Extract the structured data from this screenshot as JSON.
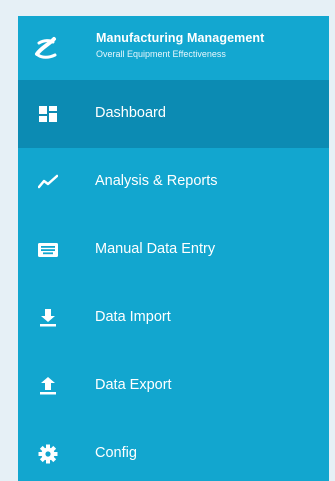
{
  "app": {
    "title": "Manufacturing Management",
    "subtitle": "Overall Equipment Effectiveness"
  },
  "menu": {
    "items": [
      {
        "label": "Dashboard",
        "icon": "dashboard-icon",
        "active": true
      },
      {
        "label": "Analysis & Reports",
        "icon": "line-chart-icon",
        "active": false
      },
      {
        "label": "Manual Data Entry",
        "icon": "keyboard-icon",
        "active": false
      },
      {
        "label": "Data Import",
        "icon": "download-icon",
        "active": false
      },
      {
        "label": "Data Export",
        "icon": "upload-icon",
        "active": false
      },
      {
        "label": "Config",
        "icon": "gear-icon",
        "active": false
      }
    ]
  },
  "colors": {
    "sidebar_bg": "#12a6cf",
    "active_bg": "#0c8bb3",
    "text": "#ffffff"
  }
}
